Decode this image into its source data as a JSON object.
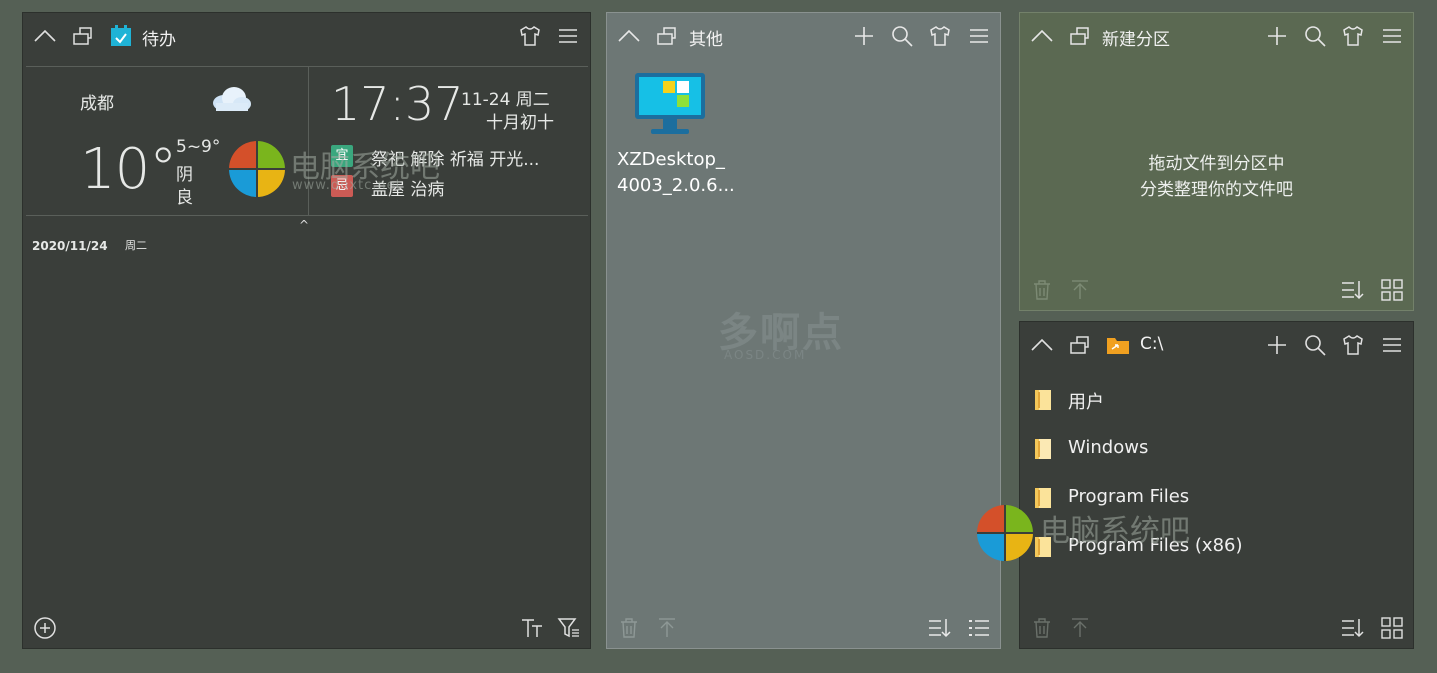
{
  "panels": {
    "todo": {
      "title": "待办",
      "weather": {
        "city": "成都",
        "temperature": "10°",
        "range": "5~9°",
        "condition": "阴",
        "air_quality": "良",
        "icon": "cloud-icon"
      },
      "calendar": {
        "time": "17:37",
        "date": "11-24  周二",
        "lunar": "十月初十",
        "yi_badge": "宜",
        "yi": "祭祀 解除 祈福 开光...",
        "ji_badge": "忌",
        "ji": "盖屋 治病"
      },
      "collapse_caret": "^",
      "todo_date": "2020/11/24",
      "todo_day": "周二"
    },
    "other": {
      "title": "其他",
      "items": [
        {
          "label_line1": "XZDesktop_",
          "label_line2": "4003_2.0.6..."
        }
      ]
    },
    "new_partition": {
      "title": "新建分区",
      "hint_line1": "拖动文件到分区中",
      "hint_line2": "分类整理你的文件吧"
    },
    "c_drive": {
      "title": "C:\\",
      "folders": [
        "用户",
        "Windows",
        "Program Files",
        "Program Files (x86)"
      ]
    }
  },
  "watermarks": {
    "brand": "电脑系统吧",
    "brand_url": "www.dnxtc.net",
    "mid": "多啊点",
    "mid_sub": "AOSD.COM"
  },
  "colors": {
    "todo_accent": "#1fb3d6",
    "folder_orange": "#f0a020",
    "yi_green": "#3aa77e",
    "ji_red": "#cc5b55"
  }
}
